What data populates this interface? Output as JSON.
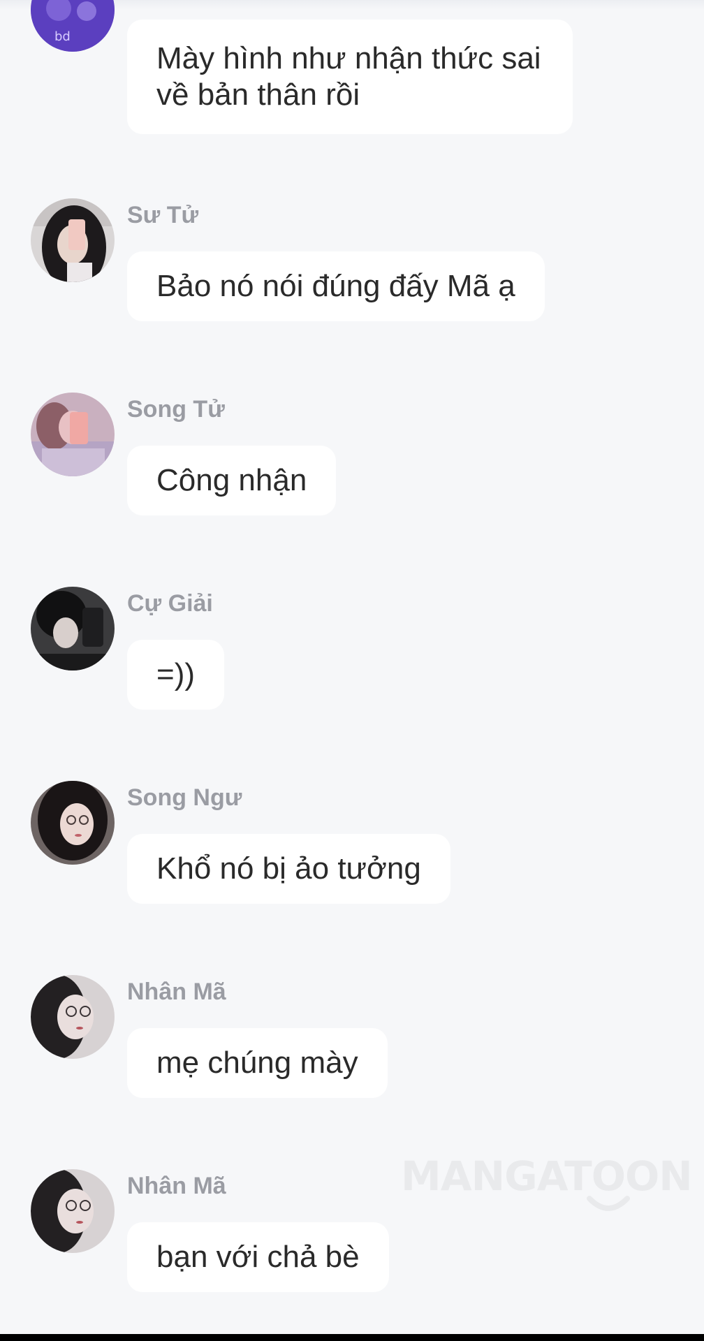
{
  "messages": [
    {
      "sender": "",
      "avatar": "purple-avatar-icon",
      "text": "Mày hình như nhận thức sai về bản thân rồi"
    },
    {
      "sender": "Sư Tử",
      "avatar": "girl-phone-avatar-icon",
      "text": "Bảo nó nói đúng đấy Mã ạ"
    },
    {
      "sender": "Song Tử",
      "avatar": "pink-phone-avatar-icon",
      "text": "Công nhận"
    },
    {
      "sender": "Cự Giải",
      "avatar": "dark-selfie-avatar-icon",
      "text": "=))"
    },
    {
      "sender": "Song Ngư",
      "avatar": "girl-glasses-avatar-icon",
      "text": "Khổ nó bị ảo tưởng"
    },
    {
      "sender": "Nhân Mã",
      "avatar": "blurred-girl-avatar-icon",
      "text": "mẹ chúng mày"
    },
    {
      "sender": "Nhân Mã",
      "avatar": "blurred-girl-avatar-icon",
      "text": "bạn với chả bè"
    }
  ],
  "watermark": {
    "text": "MANGATOON"
  },
  "colors": {
    "background": "#f6f7f9",
    "bubble": "#ffffff",
    "sender_name": "#9a9ca3",
    "message_text": "#2a2a2a"
  }
}
